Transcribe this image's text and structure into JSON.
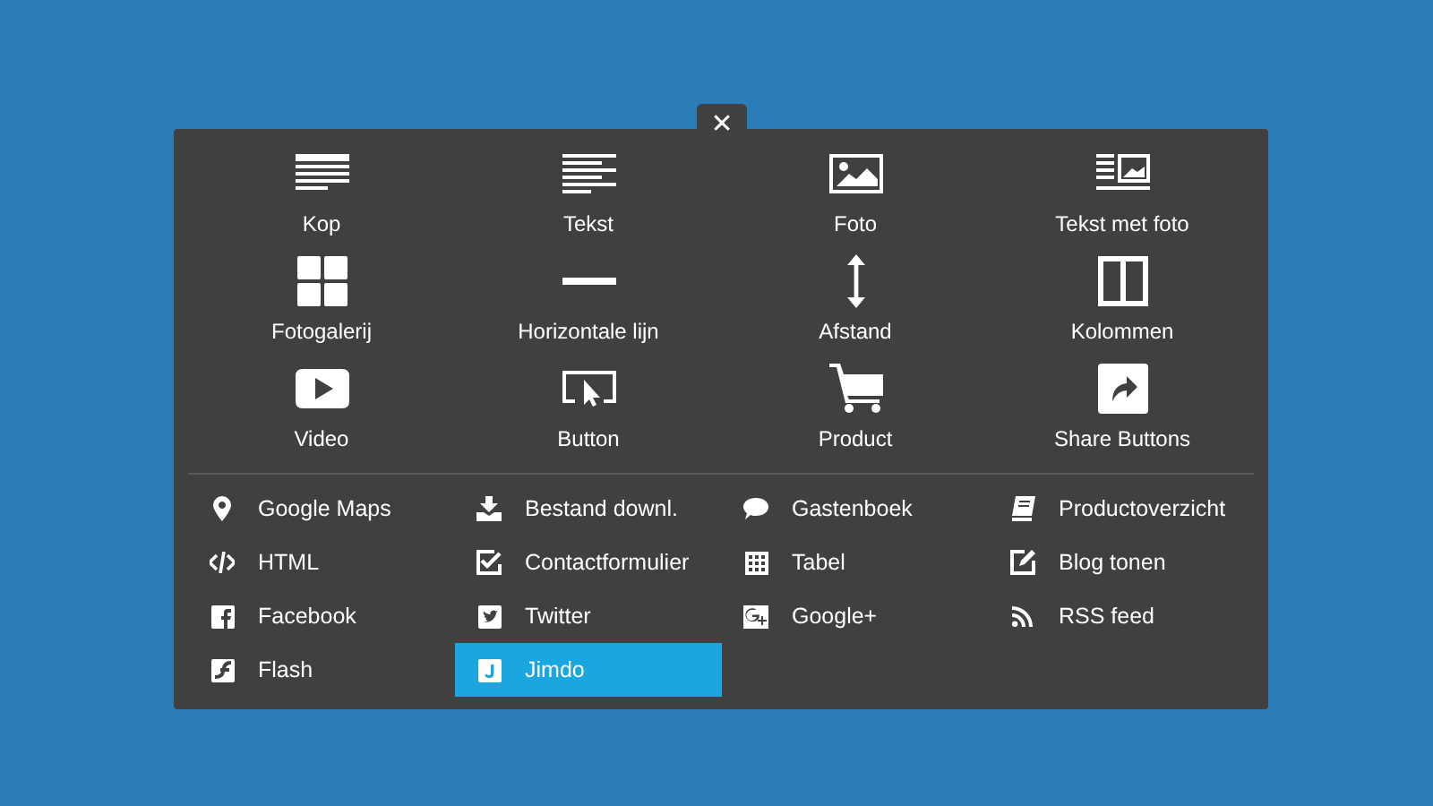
{
  "close_button": {
    "label": "✕"
  },
  "elements": [
    {
      "label": "Kop"
    },
    {
      "label": "Tekst"
    },
    {
      "label": "Foto"
    },
    {
      "label": "Tekst met foto"
    },
    {
      "label": "Fotogalerij"
    },
    {
      "label": "Horizontale lijn"
    },
    {
      "label": "Afstand"
    },
    {
      "label": "Kolommen"
    },
    {
      "label": "Video"
    },
    {
      "label": "Button"
    },
    {
      "label": "Product"
    },
    {
      "label": "Share Buttons"
    }
  ],
  "widgets": [
    {
      "label": "Google Maps",
      "selected": false
    },
    {
      "label": "Bestand downl.",
      "selected": false
    },
    {
      "label": "Gastenboek",
      "selected": false
    },
    {
      "label": "Productoverzicht",
      "selected": false
    },
    {
      "label": "HTML",
      "selected": false
    },
    {
      "label": "Contactformulier",
      "selected": false
    },
    {
      "label": "Tabel",
      "selected": false
    },
    {
      "label": "Blog tonen",
      "selected": false
    },
    {
      "label": "Facebook",
      "selected": false
    },
    {
      "label": "Twitter",
      "selected": false
    },
    {
      "label": "Google+",
      "selected": false
    },
    {
      "label": "RSS feed",
      "selected": false
    },
    {
      "label": "Flash",
      "selected": false
    },
    {
      "label": "Jimdo",
      "selected": true
    }
  ]
}
